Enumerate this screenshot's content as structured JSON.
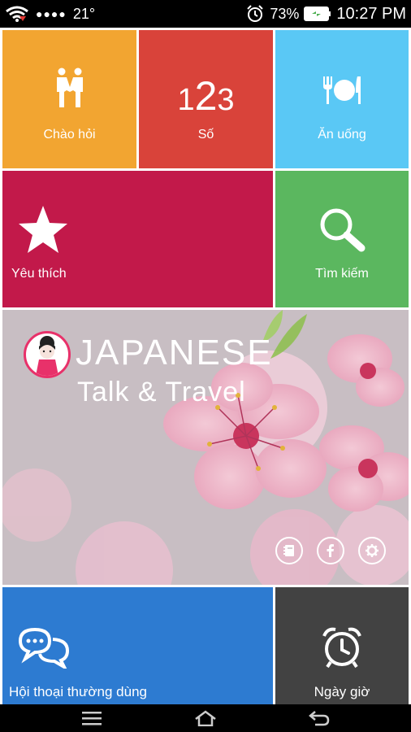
{
  "status_bar": {
    "temperature": "21°",
    "signal_dots": "●●●●",
    "battery_percent": "73%",
    "time": "10:27 PM"
  },
  "tiles": {
    "greetings": {
      "label": "Chào hỏi",
      "color": "#F2A531"
    },
    "numbers": {
      "label": "Số",
      "glyph": "123",
      "color": "#D9433A"
    },
    "food": {
      "label": "Ăn uống",
      "color": "#5AC8F5"
    },
    "favorites": {
      "label": "Yêu thích",
      "color": "#C2194A"
    },
    "search": {
      "label": "Tìm kiếm",
      "color": "#5BB75F"
    },
    "conversation": {
      "label": "Hội thoại thường dùng",
      "color": "#2D7BD1"
    },
    "datetime": {
      "label": "Ngày giờ",
      "color": "#424242"
    }
  },
  "hero": {
    "title": "JAPANESE",
    "subtitle": "Talk & Travel",
    "actions": [
      "notebook-icon",
      "facebook-icon",
      "settings-icon"
    ]
  },
  "nav_bar": {
    "buttons": [
      "menu-icon",
      "home-icon",
      "back-icon"
    ]
  }
}
